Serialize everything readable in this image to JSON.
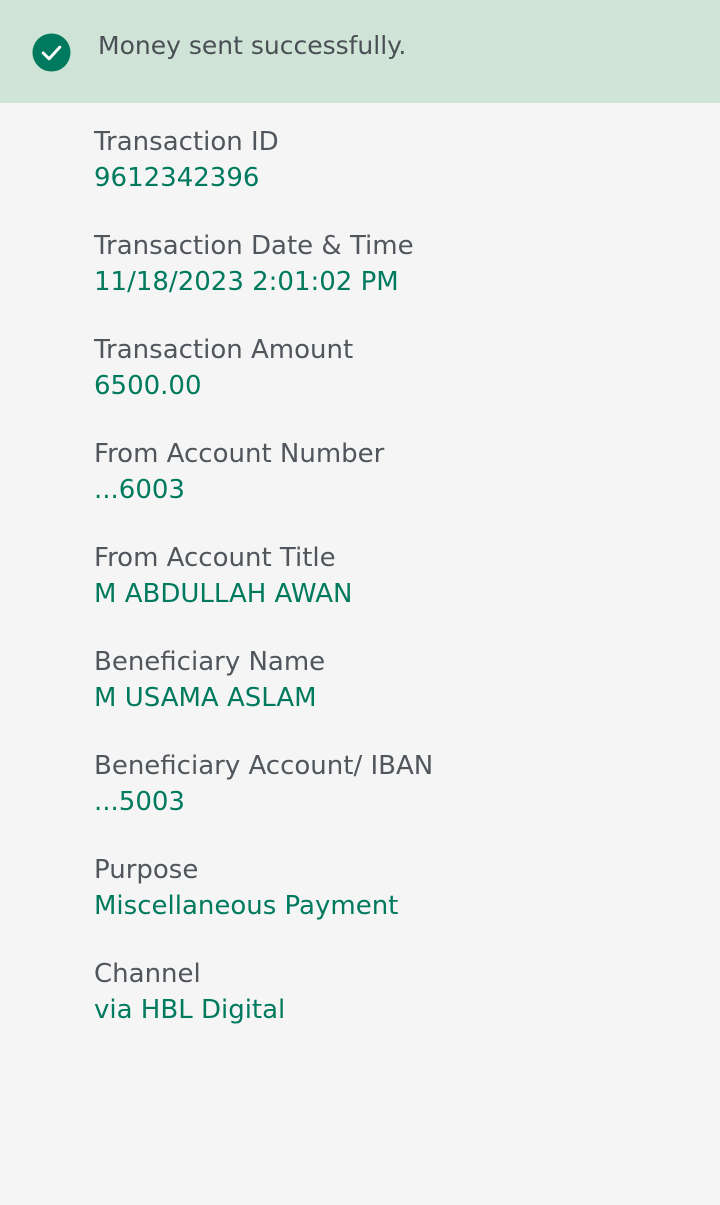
{
  "banner": {
    "message": "Money sent successfully.",
    "icon": "check-circle-icon",
    "background_color": "#cfe3d6",
    "icon_color": "#007a5e"
  },
  "details": [
    {
      "key": "transaction-id",
      "label": "Transaction ID",
      "value": "9612342396"
    },
    {
      "key": "transaction-date-time",
      "label": "Transaction Date & Time",
      "value": "11/18/2023 2:01:02 PM"
    },
    {
      "key": "transaction-amount",
      "label": "Transaction Amount",
      "value": "6500.00"
    },
    {
      "key": "from-account-number",
      "label": "From Account Number",
      "value": "...6003"
    },
    {
      "key": "from-account-title",
      "label": "From Account Title",
      "value": "M ABDULLAH AWAN"
    },
    {
      "key": "beneficiary-name",
      "label": "Beneficiary Name",
      "value": "M USAMA ASLAM"
    },
    {
      "key": "beneficiary-account-iban",
      "label": "Beneficiary Account/ IBAN",
      "value": "...5003"
    },
    {
      "key": "purpose",
      "label": "Purpose",
      "value": "Miscellaneous Payment"
    },
    {
      "key": "channel",
      "label": "Channel",
      "value": "via HBL Digital"
    }
  ],
  "colors": {
    "label": "#50565c",
    "value": "#007a5e",
    "page_background": "#f5f5f5"
  }
}
